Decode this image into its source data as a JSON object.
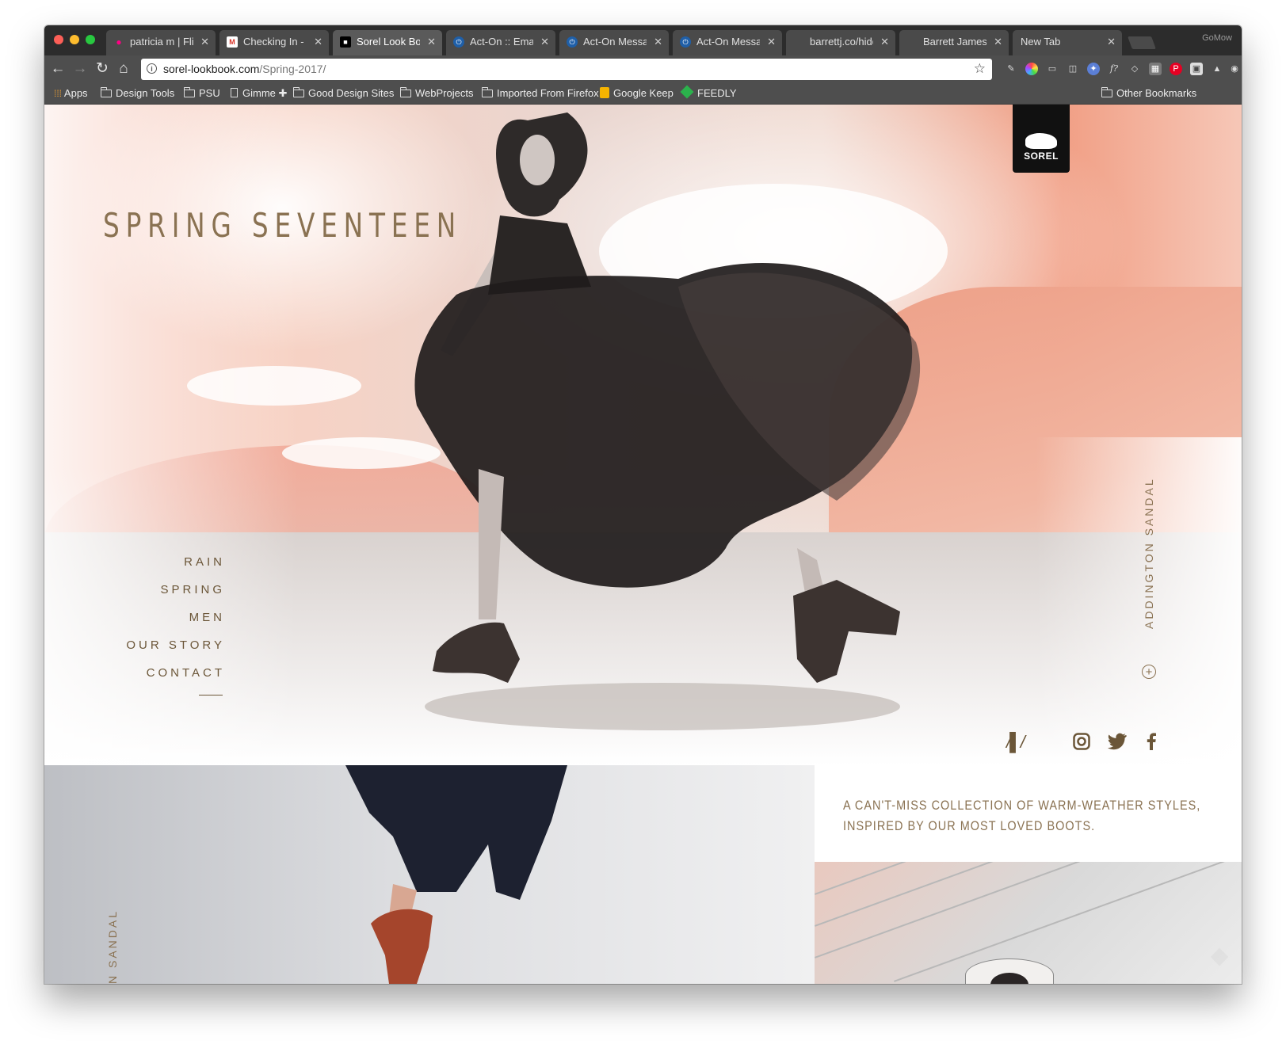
{
  "browser": {
    "tabs": [
      {
        "title": "patricia m | Flickr",
        "active": false
      },
      {
        "title": "Checking In - go",
        "active": false
      },
      {
        "title": "Sorel Look Book",
        "active": true
      },
      {
        "title": "Act-On :: Email F",
        "active": false
      },
      {
        "title": "Act-On Message",
        "active": false
      },
      {
        "title": "Act-On Message",
        "active": false
      },
      {
        "title": "barrettj.co/hidde",
        "active": false
      },
      {
        "title": "Barrett James Bu",
        "active": false
      },
      {
        "title": "New Tab",
        "active": false
      }
    ],
    "profile_name": "GoMow",
    "url_host": "sorel-lookbook.com",
    "url_path": "/Spring-2017/",
    "bookmarks": [
      "Apps",
      "Design Tools",
      "PSU",
      "Gimme ✚",
      "Good Design Sites",
      "WebProjects",
      "Imported From Firefox",
      "Google Keep",
      "FEEDLY"
    ],
    "other_bookmarks": "Other Bookmarks"
  },
  "page": {
    "logo_text": "SOREL",
    "headline": "SPRING SEVENTEEN",
    "nav": [
      "RAIN",
      "SPRING",
      "MEN",
      "OUR STORY",
      "CONTACT"
    ],
    "product_label_hero": "ADDINGTON SANDAL",
    "product_label_lower": "N SANDAL",
    "tagline_line1": "A CAN'T-MISS COLLECTION OF WARM-WEATHER STYLES,",
    "tagline_line2": "INSPIRED BY OUR MOST LOVED BOOTS."
  },
  "colors": {
    "brand_gold": "#8a7252",
    "nav_brown": "#6b5638",
    "accent_coral": "#f19f85",
    "chrome_dark": "#2c2c2c"
  }
}
